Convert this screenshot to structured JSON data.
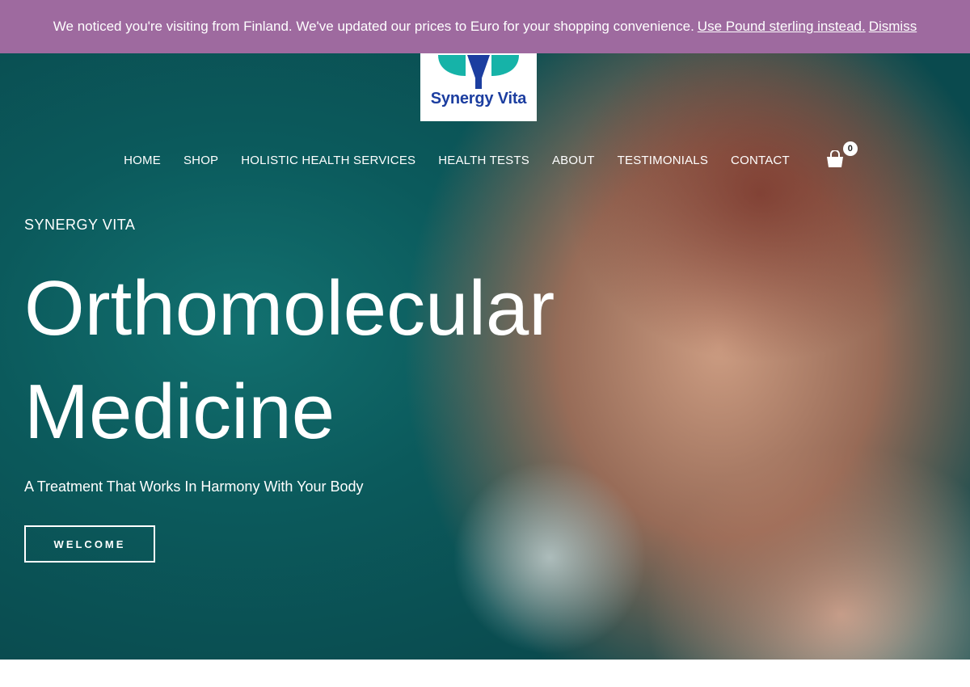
{
  "notice": {
    "message": "We noticed you're visiting from Finland. We've updated our prices to Euro for your shopping convenience.",
    "currency_link": "Use Pound sterling instead.",
    "dismiss_link": "Dismiss"
  },
  "logo": {
    "text": "Synergy Vita"
  },
  "nav": {
    "items": [
      "HOME",
      "SHOP",
      "HOLISTIC HEALTH SERVICES",
      "HEALTH TESTS",
      "ABOUT",
      "TESTIMONIALS",
      "CONTACT"
    ],
    "cart_count": "0"
  },
  "hero": {
    "kicker": "SYNERGY VITA",
    "headline_line1": "Orthomolecular",
    "headline_line2": "Medicine",
    "tagline": "A Treatment That Works In Harmony With Your Body",
    "button_label": "WELCOME"
  },
  "icons": [
    "cart-icon",
    "logo-mark-icon"
  ],
  "colors": {
    "notice_bg": "#9e6a9f",
    "logo_blue": "#1c3ea0",
    "logo_teal": "#16b3a8",
    "hero_teal": "#0b5a5c"
  }
}
